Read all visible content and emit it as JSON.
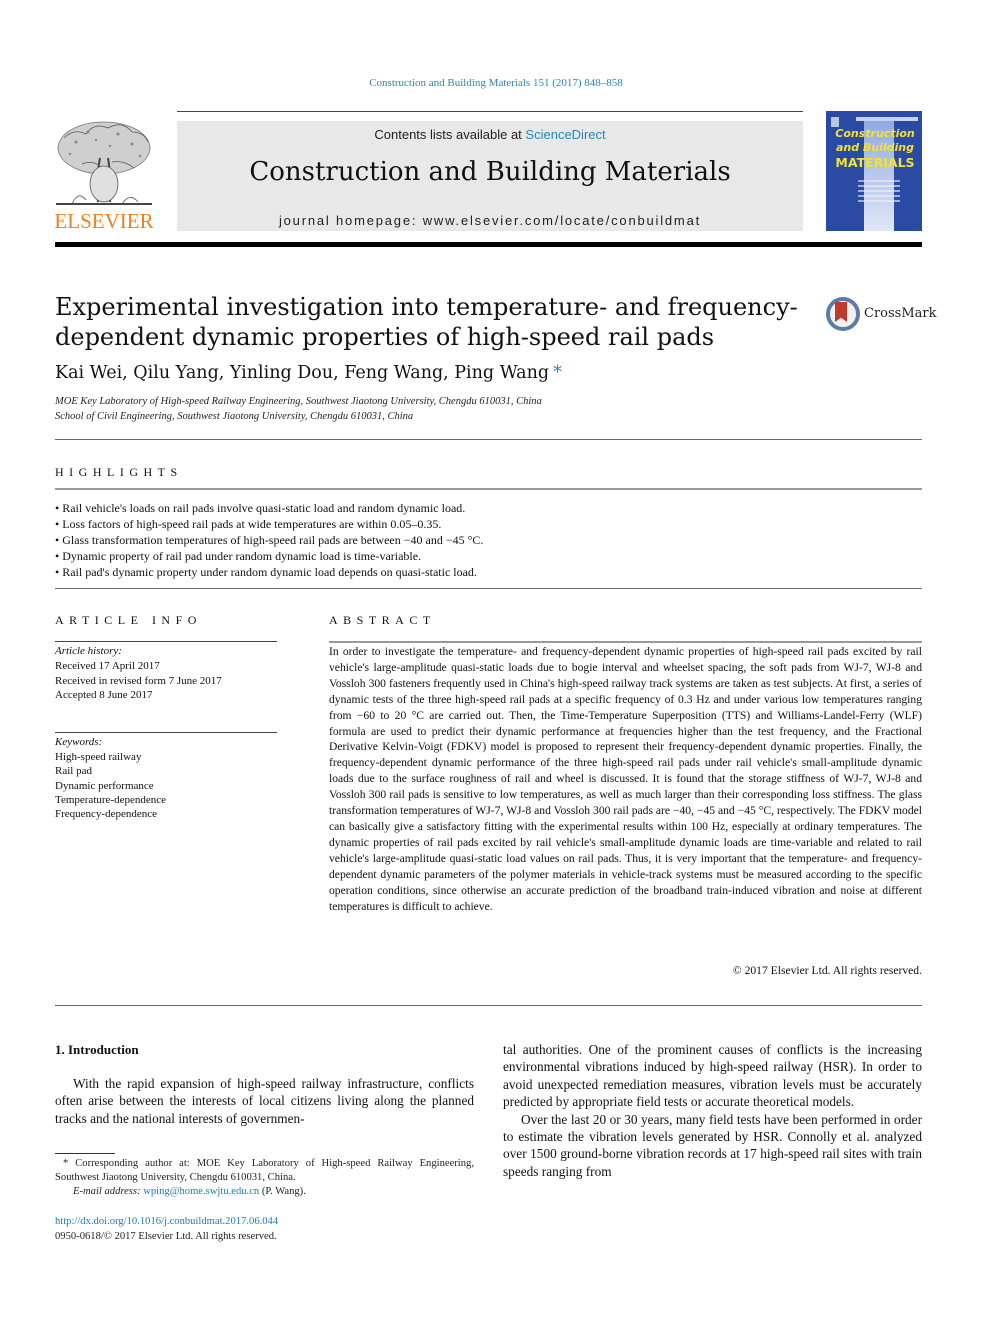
{
  "citation": "Construction and Building Materials 151 (2017) 848–858",
  "header": {
    "publisher_logo_text": "ELSEVIER",
    "contents_prefix": "Contents lists available at",
    "contents_link": "ScienceDirect",
    "journal_name": "Construction and Building Materials",
    "homepage_label": "journal homepage:",
    "homepage_url": "www.elsevier.com/locate/conbuildmat",
    "cover": {
      "title_line1": "Construction",
      "title_line2": "and Building",
      "title_line3": "MATERIALS",
      "bg_color": "#2a4aa3",
      "title_color": "#f4e233"
    }
  },
  "article": {
    "title": "Experimental investigation into temperature- and frequency-dependent dynamic properties of high-speed rail pads",
    "crossmark_label": "CrossMark",
    "authors": "Kai Wei, Qilu Yang, Yinling Dou, Feng Wang, Ping Wang",
    "corresponding_mark": "*",
    "affiliations": [
      "MOE Key Laboratory of High-speed Railway Engineering, Southwest Jiaotong University, Chengdu 610031, China",
      "School of Civil Engineering, Southwest Jiaotong University, Chengdu 610031, China"
    ]
  },
  "highlights": {
    "heading": "HIGHLIGHTS",
    "items": [
      "Rail vehicle's loads on rail pads involve quasi-static load and random dynamic load.",
      "Loss factors of high-speed rail pads at wide temperatures are within 0.05–0.35.",
      "Glass transformation temperatures of high-speed rail pads are between −40 and −45 °C.",
      "Dynamic property of rail pad under random dynamic load is time-variable.",
      "Rail pad's dynamic property under random dynamic load depends on quasi-static load."
    ]
  },
  "article_info": {
    "heading": "ARTICLE INFO",
    "history_label": "Article history:",
    "history": [
      "Received 17 April 2017",
      "Received in revised form 7 June 2017",
      "Accepted 8 June 2017"
    ],
    "keywords_label": "Keywords:",
    "keywords": [
      "High-speed railway",
      "Rail pad",
      "Dynamic performance",
      "Temperature-dependence",
      "Frequency-dependence"
    ]
  },
  "abstract": {
    "heading": "ABSTRACT",
    "text": "In order to investigate the temperature- and frequency-dependent dynamic properties of high-speed rail pads excited by rail vehicle's large-amplitude quasi-static loads due to bogie interval and wheelset spacing, the soft pads from WJ-7, WJ-8 and Vossloh 300 fasteners frequently used in China's high-speed railway track systems are taken as test subjects. At first, a series of dynamic tests of the three high-speed rail pads at a specific frequency of 0.3 Hz and under various low temperatures ranging from −60 to 20 °C are carried out. Then, the Time-Temperature Superposition (TTS) and Williams-Landel-Ferry (WLF) formula are used to predict their dynamic performance at frequencies higher than the test frequency, and the Fractional Derivative Kelvin-Voigt (FDKV) model is proposed to represent their frequency-dependent dynamic properties. Finally, the frequency-dependent dynamic performance of the three high-speed rail pads under rail vehicle's small-amplitude dynamic loads due to the surface roughness of rail and wheel is discussed. It is found that the storage stiffness of WJ-7, WJ-8 and Vossloh 300 rail pads is sensitive to low temperatures, as well as much larger than their corresponding loss stiffness. The glass transformation temperatures of WJ-7, WJ-8 and Vossloh 300 rail pads are −40, −45 and −45 °C, respectively. The FDKV model can basically give a satisfactory fitting with the experimental results within 100 Hz, especially at ordinary temperatures. The dynamic properties of rail pads excited by rail vehicle's small-amplitude dynamic loads are time-variable and related to rail vehicle's large-amplitude quasi-static load values on rail pads. Thus, it is very important that the temperature- and frequency-dependent dynamic parameters of the polymer materials in vehicle-track systems must be measured according to the specific operation conditions, since otherwise an accurate prediction of the broadband train-induced vibration and noise at different temperatures is difficult to achieve.",
    "copyright": "© 2017 Elsevier Ltd. All rights reserved."
  },
  "body": {
    "intro_heading": "1. Introduction",
    "left_para": "With the rapid expansion of high-speed railway infrastructure, conflicts often arise between the interests of local citizens living along the planned tracks and the national interests of governmen-",
    "right_para1": "tal authorities. One of the prominent causes of conflicts is the increasing environmental vibrations induced by high-speed railway (HSR). In order to avoid unexpected remediation measures, vibration levels must be accurately predicted by appropriate field tests or accurate theoretical models.",
    "right_para2": "Over the last 20 or 30 years, many field tests have been performed in order to estimate the vibration levels generated by HSR. Connolly et al. analyzed over 1500 ground-borne vibration records at 17 high-speed rail sites with train speeds ranging from"
  },
  "footnote": {
    "corresponding": "* Corresponding author at: MOE Key Laboratory of High-speed Railway Engineering, Southwest Jiaotong University, Chengdu 610031, China.",
    "email_label": "E-mail address:",
    "email": "wping@home.swjtu.edu.cn",
    "email_suffix": "(P. Wang).",
    "doi": "http://dx.doi.org/10.1016/j.conbuildmat.2017.06.044",
    "issn": "0950-0618/© 2017 Elsevier Ltd. All rights reserved."
  }
}
